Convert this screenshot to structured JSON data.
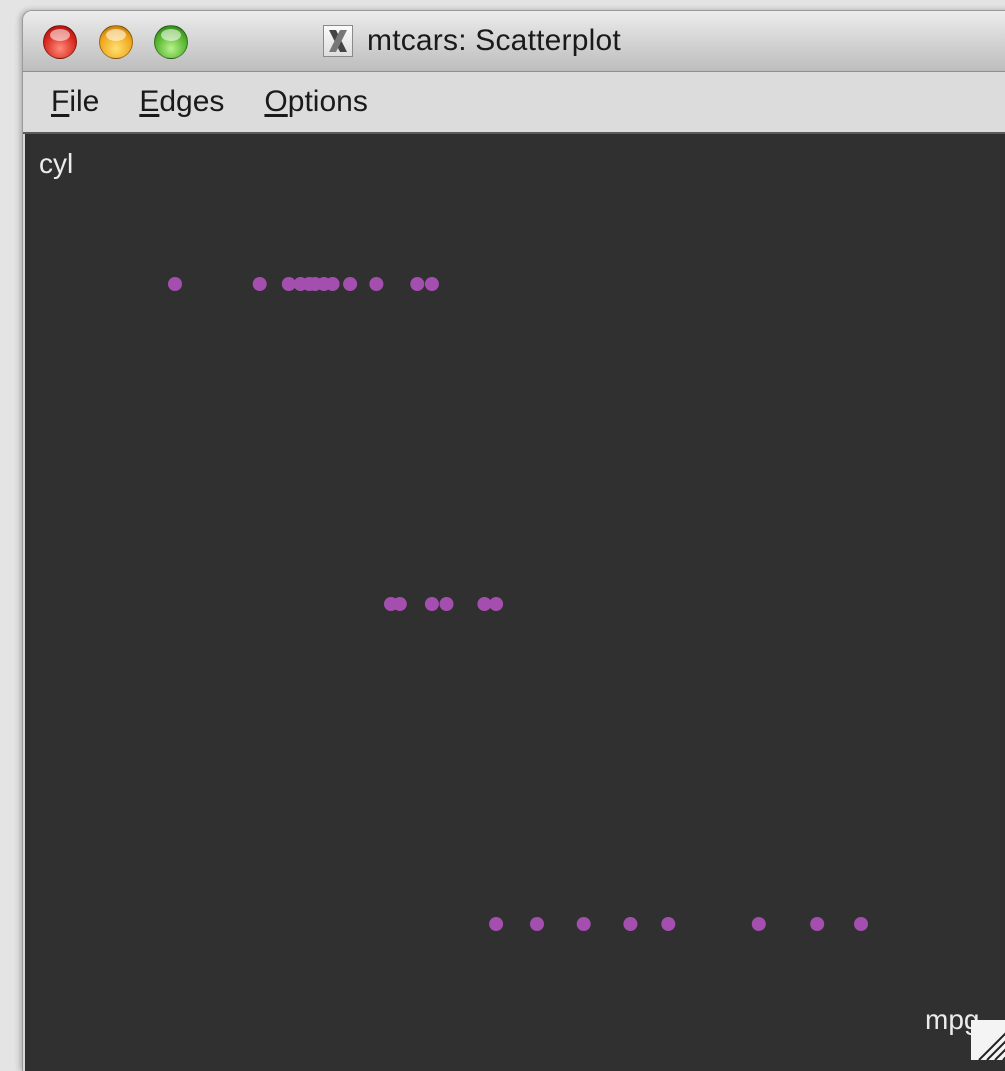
{
  "window": {
    "title": "mtcars: Scatterplot",
    "app_icon": "x11-icon"
  },
  "menu": {
    "file": {
      "accel": "F",
      "rest": "ile"
    },
    "edges": {
      "accel": "E",
      "rest": "dges"
    },
    "options": {
      "accel": "O",
      "rest": "ptions"
    }
  },
  "colors": {
    "point": "#a44fb0",
    "background": "#303030"
  },
  "chart_data": {
    "type": "scatter",
    "xlabel": "mpg",
    "ylabel": "cyl",
    "xlim": [
      10.4,
      33.9
    ],
    "ylim": [
      4,
      8
    ],
    "points": [
      {
        "x": 10.4,
        "y": 8
      },
      {
        "x": 13.3,
        "y": 8
      },
      {
        "x": 14.3,
        "y": 8
      },
      {
        "x": 14.7,
        "y": 8
      },
      {
        "x": 15.0,
        "y": 8
      },
      {
        "x": 15.2,
        "y": 8
      },
      {
        "x": 15.5,
        "y": 8
      },
      {
        "x": 15.8,
        "y": 8
      },
      {
        "x": 16.4,
        "y": 8
      },
      {
        "x": 17.3,
        "y": 8
      },
      {
        "x": 18.7,
        "y": 8
      },
      {
        "x": 19.2,
        "y": 8
      },
      {
        "x": 17.8,
        "y": 6
      },
      {
        "x": 18.1,
        "y": 6
      },
      {
        "x": 19.2,
        "y": 6
      },
      {
        "x": 19.7,
        "y": 6
      },
      {
        "x": 21.0,
        "y": 6
      },
      {
        "x": 21.4,
        "y": 6
      },
      {
        "x": 21.4,
        "y": 4
      },
      {
        "x": 22.8,
        "y": 4
      },
      {
        "x": 24.4,
        "y": 4
      },
      {
        "x": 26.0,
        "y": 4
      },
      {
        "x": 27.3,
        "y": 4
      },
      {
        "x": 30.4,
        "y": 4
      },
      {
        "x": 32.4,
        "y": 4
      },
      {
        "x": 33.9,
        "y": 4
      }
    ]
  }
}
